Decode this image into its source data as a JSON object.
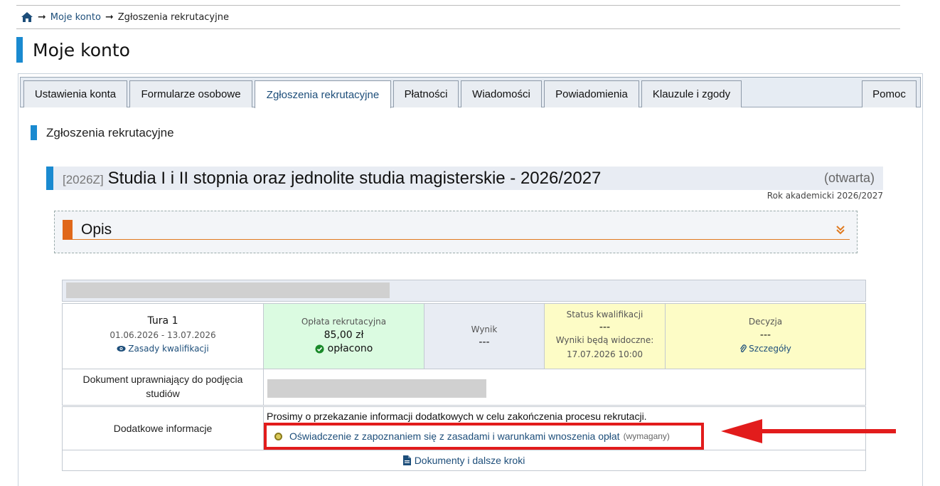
{
  "breadcrumb": {
    "items": [
      "Moje konto",
      "Zgłoszenia rekrutacyjne"
    ]
  },
  "page": {
    "title": "Moje konto"
  },
  "tabs": [
    {
      "label": "Ustawienia konta"
    },
    {
      "label": "Formularze osobowe"
    },
    {
      "label": "Zgłoszenia rekrutacyjne"
    },
    {
      "label": "Płatności"
    },
    {
      "label": "Wiadomości"
    },
    {
      "label": "Powiadomienia"
    },
    {
      "label": "Klauzule i zgody"
    },
    {
      "label": "Pomoc"
    }
  ],
  "section": {
    "title": "Zgłoszenia rekrutacyjne"
  },
  "recruitment": {
    "code": "[2026Z]",
    "name": "Studia I i II stopnia oraz jednolite studia magisterskie - 2026/2027",
    "status": "(otwarta)",
    "academic_year": "Rok akademicki 2026/2027"
  },
  "opis": {
    "title": "Opis"
  },
  "tura": {
    "title": "Tura 1",
    "dates": "01.06.2026 - 13.07.2026",
    "link": "Zasady kwalifikacji"
  },
  "oplata": {
    "label": "Opłata rekrutacyjna",
    "amount": "85,00 zł",
    "status": "opłacono"
  },
  "wynik": {
    "label": "Wynik",
    "value": "---"
  },
  "status_kwalifikacji": {
    "label": "Status kwalifikacji",
    "value": "---",
    "results_label": "Wyniki będą widoczne:",
    "results_date": "17.07.2026 10:00"
  },
  "decyzja": {
    "label": "Decyzja",
    "value": "---",
    "link": "Szczegóły"
  },
  "dokument": {
    "label": "Dokument uprawniający do podjęcia studiów"
  },
  "dodatkowe": {
    "label": "Dodatkowe informacje",
    "text": "Prosimy o przekazanie informacji dodatkowych w celu zakończenia procesu rekrutacji.",
    "item": "Oświadczenie z zapoznaniem się z zasadami i warunkami wnoszenia opłat",
    "item_note": "(wymagany)"
  },
  "documents_link": "Dokumenty i dalsze kroki",
  "colors": {
    "accent_blue": "#1a8ad0",
    "accent_orange": "#e0681a",
    "annotation_red": "#e21c1c",
    "paid_green": "#dbfbe1",
    "yellow": "#fdfcc6"
  }
}
